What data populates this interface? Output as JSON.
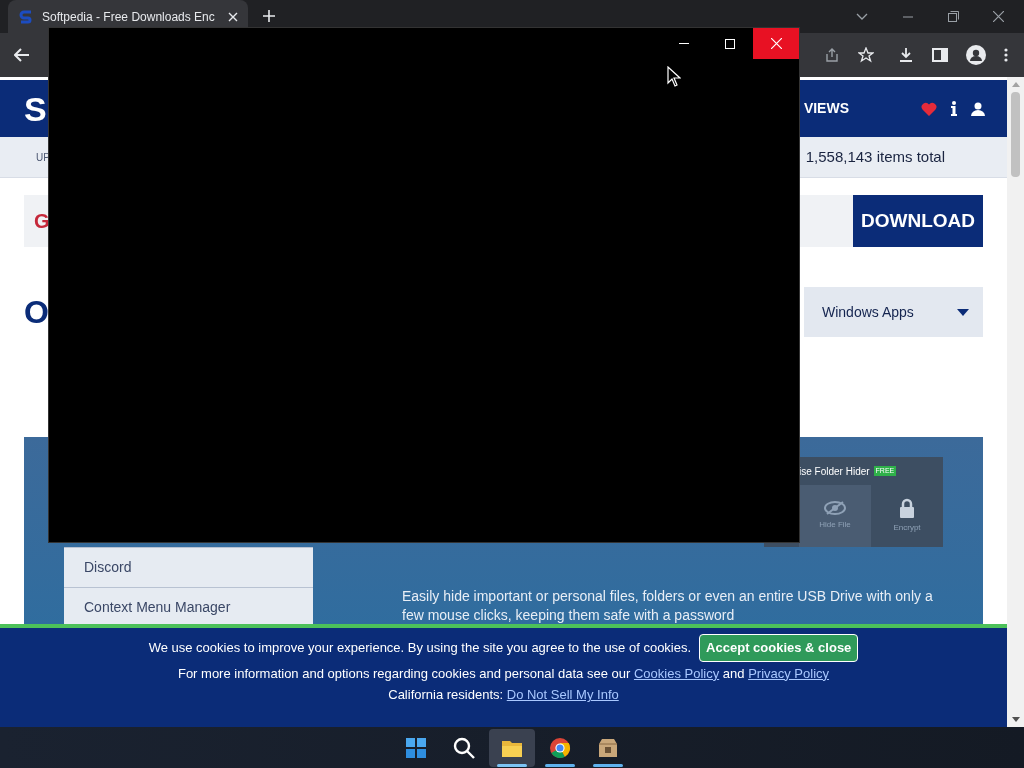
{
  "browser": {
    "tabs": [
      {
        "title": "Softpedia - Free Downloads Enc",
        "selected": true
      }
    ]
  },
  "site": {
    "logo_fragment": "S",
    "nav_fragment": "VIEWS",
    "subnav_fragment": "UP",
    "items_total": "1,558,143 items total",
    "search_fragment": "G",
    "download_button": "DOWNLOAD",
    "heading_fragment": "O",
    "platform_select": "Windows Apps",
    "sidebar_items": [
      "Discord",
      "Context Menu Manager"
    ],
    "app_preview": {
      "title": "ise Folder Hider",
      "badge": "FREE",
      "actions": [
        {
          "kind": "hide",
          "label": "Hide File"
        },
        {
          "kind": "lock",
          "label": "Encrypt"
        }
      ]
    },
    "description": "Easily hide important or personal files, folders or even an entire USB Drive with only a few mouse clicks, keeping them safe with a password"
  },
  "cookie_banner": {
    "message": "We use cookies to improve your experience. By using the site you agree to the use of cookies.",
    "accept_button": "Accept cookies & close",
    "info": "For more information and options regarding cookies and personal data see our",
    "links": [
      "Cookies Policy",
      "Privacy Policy"
    ],
    "conjunction": "and",
    "california_label": "California residents:",
    "california_link": "Do Not Sell My Info"
  },
  "taskbar": [
    {
      "kind": "start",
      "selected": false,
      "running": false
    },
    {
      "kind": "search",
      "selected": false,
      "running": false
    },
    {
      "kind": "folder",
      "selected": true,
      "running": true
    },
    {
      "kind": "browser",
      "selected": false,
      "running": true
    },
    {
      "kind": "package",
      "selected": false,
      "running": true
    }
  ]
}
